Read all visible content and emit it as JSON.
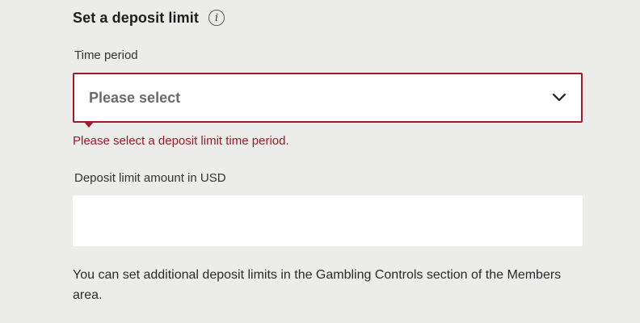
{
  "heading": {
    "title": "Set a deposit limit",
    "info_icon": "info-icon"
  },
  "time_period": {
    "label": "Time period",
    "selected": "Please select",
    "icon": "chevron-down-icon",
    "error": "Please select a deposit limit time period.",
    "error_color": "#9b1c24"
  },
  "amount": {
    "label": "Deposit limit amount in USD",
    "value": "",
    "placeholder": ""
  },
  "note": "You can set additional deposit limits in the Gambling Controls section of the Members area."
}
